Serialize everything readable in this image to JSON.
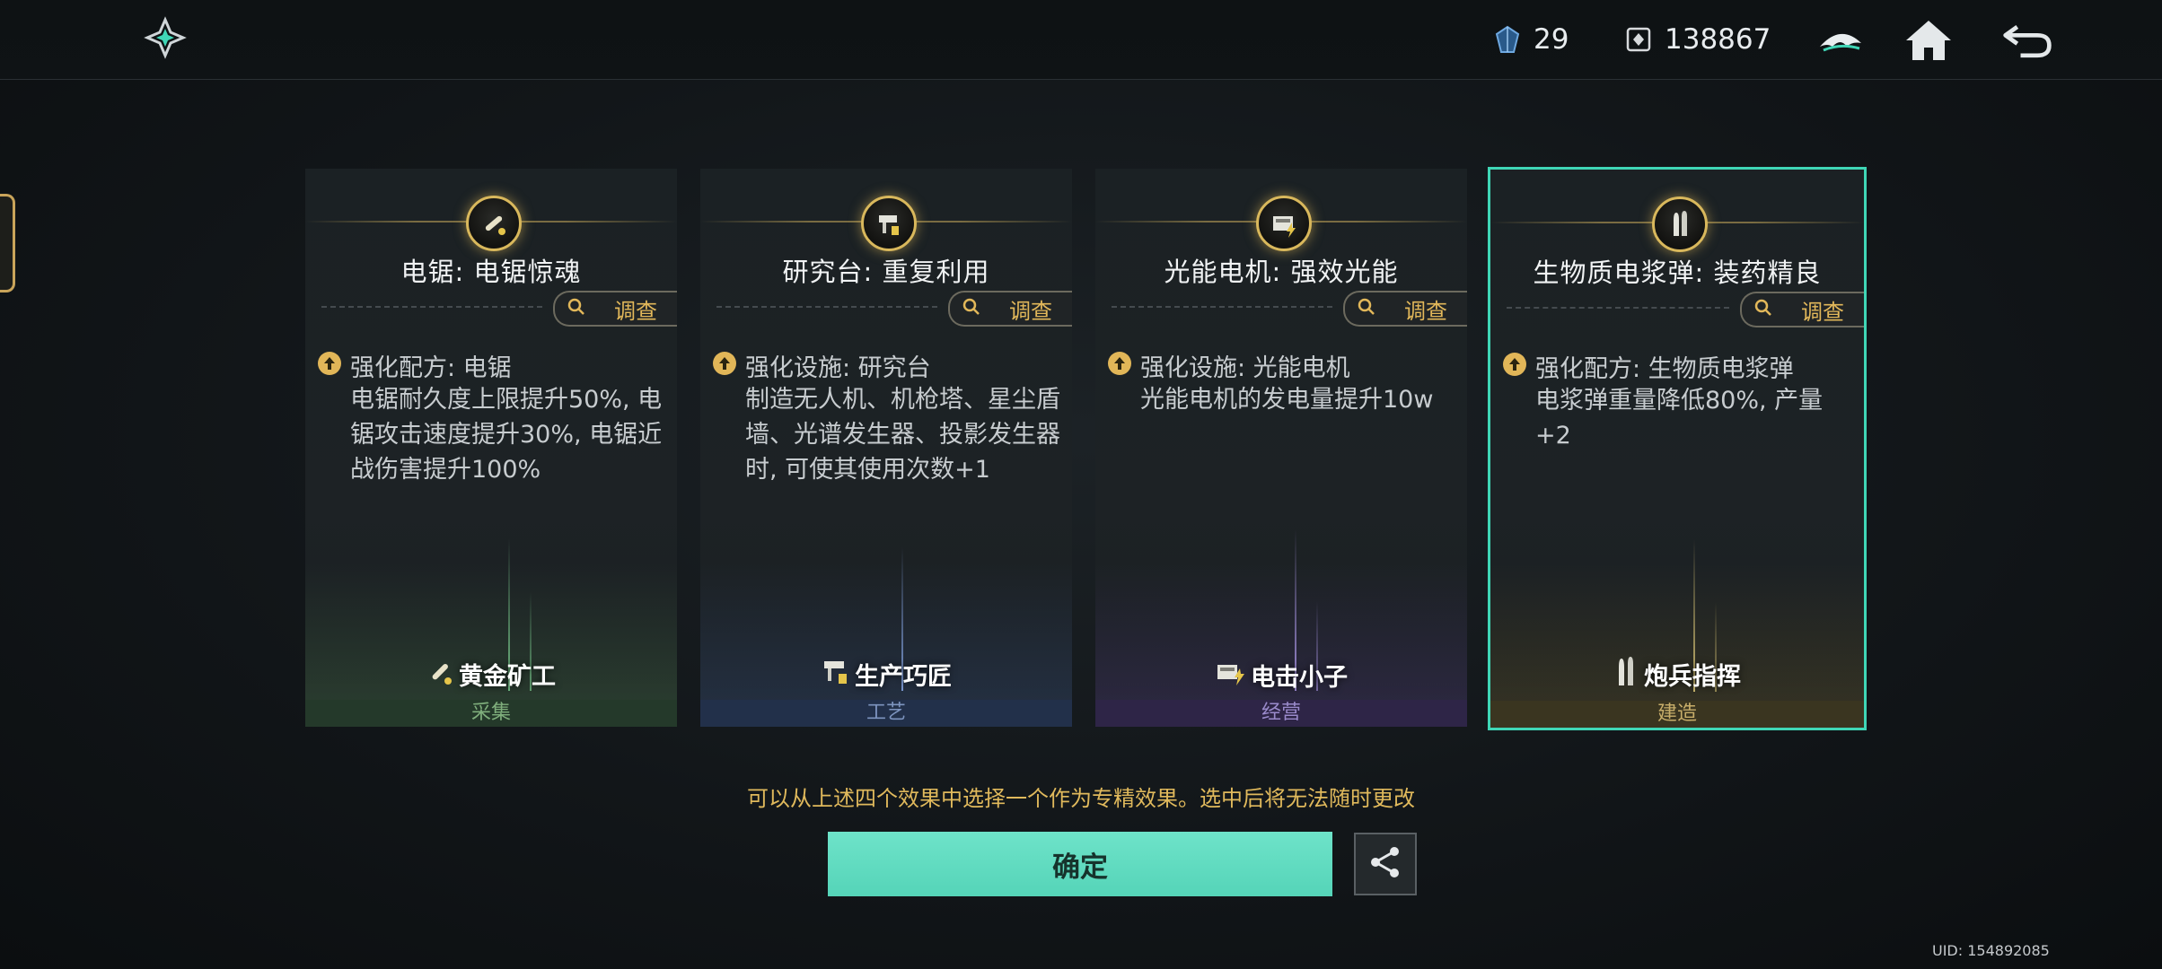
{
  "topbar": {
    "resource1_value": "29",
    "resource2_value": "138867"
  },
  "cards": [
    {
      "title": "电锯: 电锯惊魂",
      "investigate_label": "调查",
      "effect_head": "强化配方: 电锯",
      "effect_body": "电锯耐久度上限提升50%, 电锯攻击速度提升30%, 电锯近战伤害提升100%",
      "role": "黄金矿工",
      "category": "采集",
      "accent": "#3a5a3c",
      "cat_color": "#7fae7c",
      "selected": false
    },
    {
      "title": "研究台: 重复利用",
      "investigate_label": "调查",
      "effect_head": "强化设施: 研究台",
      "effect_body": "制造无人机、机枪塔、星尘盾墙、光谱发生器、投影发生器时, 可使其使用次数+1",
      "role": "生产巧匠",
      "category": "工艺",
      "accent": "#2c3d5c",
      "cat_color": "#7d94bf",
      "selected": false
    },
    {
      "title": "光能电机: 强效光能",
      "investigate_label": "调查",
      "effect_head": "强化设施: 光能电机",
      "effect_body": "光能电机的发电量提升10w",
      "role": "电击小子",
      "category": "经营",
      "accent": "#3a2f59",
      "cat_color": "#9a8acb",
      "selected": false
    },
    {
      "title": "生物质电浆弹: 装药精良",
      "investigate_label": "调查",
      "effect_head": "强化配方: 生物质电浆弹",
      "effect_body": "电浆弹重量降低80%, 产量+2",
      "role": "炮兵指挥",
      "category": "建造",
      "accent": "#4a4224",
      "cat_color": "#c8ae6a",
      "selected": true
    }
  ],
  "hint": "可以从上述四个效果中选择一个作为专精效果。选中后将无法随时更改",
  "confirm_label": "确定",
  "uid": "UID: 154892085",
  "colors": {
    "selection_border": "#3fd6b6",
    "confirm_bg": "#5fdac0",
    "gold_text": "#e0b95c"
  },
  "icons": [
    "logo-shuriken-icon",
    "crystal-icon",
    "coin-icon",
    "hat-icon",
    "home-icon",
    "back-icon",
    "search-icon",
    "upgrade-arrow-icon",
    "share-icon"
  ]
}
